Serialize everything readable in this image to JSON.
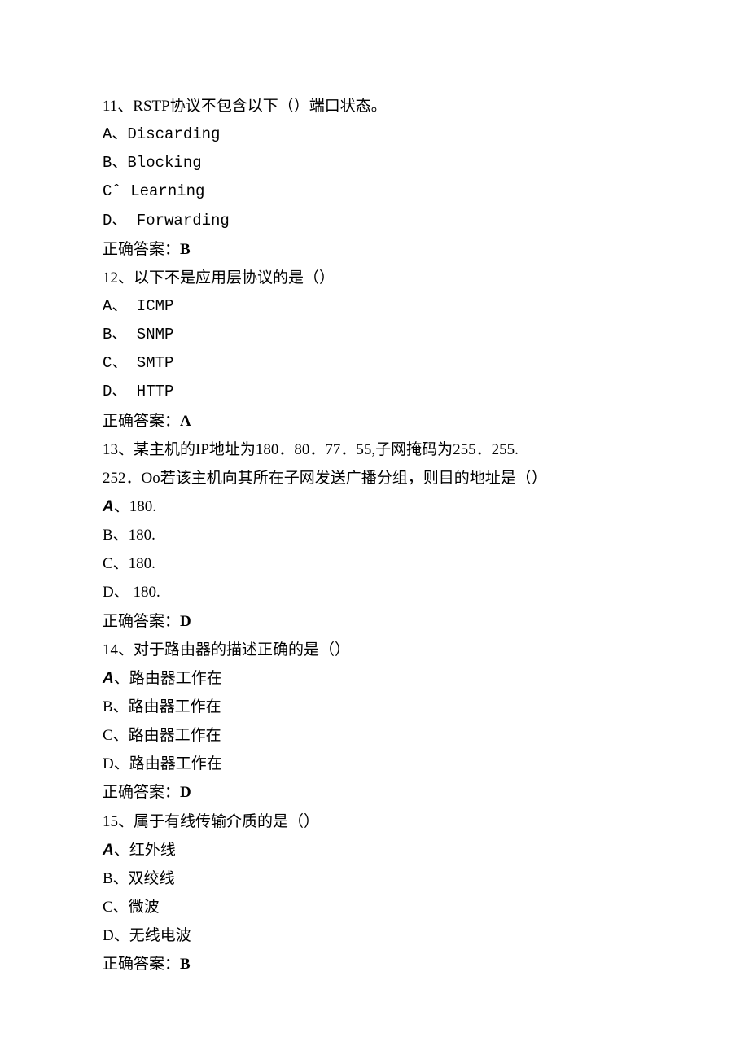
{
  "q11": {
    "stem": "11、RSTP协议不包含以下（）端口状态。",
    "optA": "A、Discarding",
    "optB": "B、Blocking",
    "optC": "Cˆ Learning",
    "optD": "D、 Forwarding",
    "ansLabel": "正确答案：",
    "ansValue": "B"
  },
  "q12": {
    "stem": "12、以下不是应用层协议的是（）",
    "optA": "A、 ICMP",
    "optB": "B、 SNMP",
    "optC": "C、 SMTP",
    "optD": "D、 HTTP",
    "ansLabel": "正确答案：",
    "ansValue": "A"
  },
  "q13": {
    "stem1": "13、某主机的IP地址为180．80．77．55,子网掩码为255．255.",
    "stem2": "252．Oo若该主机向其所在子网发送广播分组，则目的地址是（）",
    "optA_prefix": "A",
    "optA_rest": "、180.",
    "optB": "B、180.",
    "optC": "C、180.",
    "optD": "D、 180.",
    "ansLabel": "正确答案：",
    "ansValue": "D"
  },
  "q14": {
    "stem": "14、对于路由器的描述正确的是（）",
    "optA_prefix": "A",
    "optA_rest": "、路由器工作在",
    "optB": "B、路由器工作在",
    "optC": "C、路由器工作在",
    "optD": "D、路由器工作在",
    "ansLabel": "正确答案：",
    "ansValue": "D"
  },
  "q15": {
    "stem": "15、属于有线传输介质的是（）",
    "optA_prefix": "A",
    "optA_rest": "、红外线",
    "optB": "B、双绞线",
    "optC": "C、微波",
    "optD": "D、无线电波",
    "ansLabel": "正确答案：",
    "ansValue": "B"
  }
}
